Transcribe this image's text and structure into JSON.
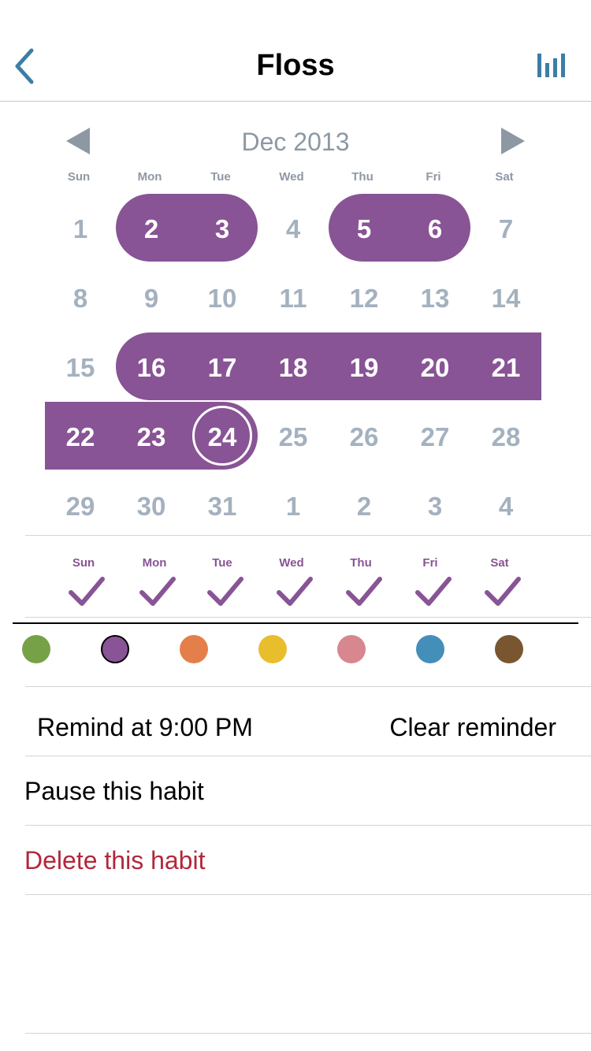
{
  "header": {
    "title": "Floss",
    "back_icon": "chevron-left-icon",
    "stats_icon": "bar-chart-icon",
    "accent": "#3d7ea6"
  },
  "calendar": {
    "month_label": "Dec 2013",
    "prev_icon": "triangle-left-icon",
    "next_icon": "triangle-right-icon",
    "weekday_labels": [
      "Sun",
      "Mon",
      "Tue",
      "Wed",
      "Thu",
      "Fri",
      "Sat"
    ],
    "weeks": [
      [
        {
          "label": "1",
          "done": false
        },
        {
          "label": "2",
          "done": true
        },
        {
          "label": "3",
          "done": true
        },
        {
          "label": "4",
          "done": false
        },
        {
          "label": "5",
          "done": true
        },
        {
          "label": "6",
          "done": true
        },
        {
          "label": "7",
          "done": false
        }
      ],
      [
        {
          "label": "8",
          "done": false
        },
        {
          "label": "9",
          "done": false
        },
        {
          "label": "10",
          "done": false
        },
        {
          "label": "11",
          "done": false
        },
        {
          "label": "12",
          "done": false
        },
        {
          "label": "13",
          "done": false
        },
        {
          "label": "14",
          "done": false
        }
      ],
      [
        {
          "label": "15",
          "done": false
        },
        {
          "label": "16",
          "done": true
        },
        {
          "label": "17",
          "done": true
        },
        {
          "label": "18",
          "done": true
        },
        {
          "label": "19",
          "done": true
        },
        {
          "label": "20",
          "done": true
        },
        {
          "label": "21",
          "done": true
        }
      ],
      [
        {
          "label": "22",
          "done": true
        },
        {
          "label": "23",
          "done": true
        },
        {
          "label": "24",
          "done": true,
          "today": true
        },
        {
          "label": "25",
          "done": false
        },
        {
          "label": "26",
          "done": false
        },
        {
          "label": "27",
          "done": false
        },
        {
          "label": "28",
          "done": false
        }
      ],
      [
        {
          "label": "29",
          "done": false
        },
        {
          "label": "30",
          "done": false
        },
        {
          "label": "31",
          "done": false
        },
        {
          "label": "1",
          "done": false
        },
        {
          "label": "2",
          "done": false
        },
        {
          "label": "3",
          "done": false
        },
        {
          "label": "4",
          "done": false
        }
      ]
    ],
    "done_color": "#885495",
    "idle_text_color": "#a4b1bf"
  },
  "schedule": {
    "days": [
      "Sun",
      "Mon",
      "Tue",
      "Wed",
      "Thu",
      "Fri",
      "Sat"
    ],
    "checked": [
      true,
      true,
      true,
      true,
      true,
      true,
      true
    ],
    "check_icon": "checkmark-icon"
  },
  "colors": {
    "options": [
      "#77a146",
      "#885495",
      "#e47f4b",
      "#e8be2c",
      "#d8868f",
      "#448fba",
      "#7a5630"
    ],
    "selected_index": 1
  },
  "reminder": {
    "label": "Remind at 9:00 PM",
    "clear_label": "Clear reminder"
  },
  "actions": {
    "pause_label": "Pause this habit",
    "delete_label": "Delete this habit",
    "delete_color": "#b3273b"
  }
}
